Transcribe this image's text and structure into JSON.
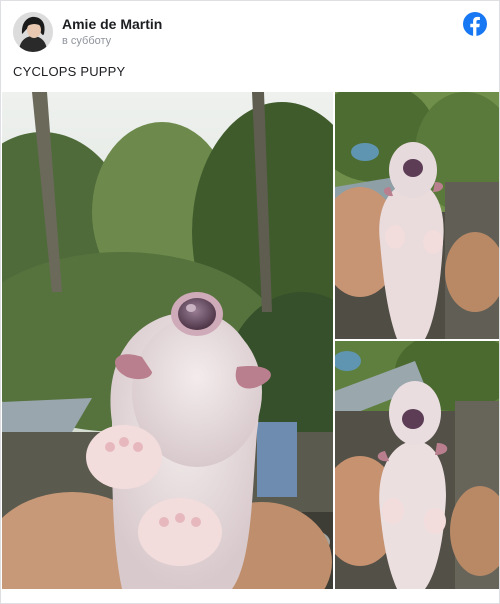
{
  "post": {
    "author": "Amie de Martin",
    "timestamp": "в субботу",
    "text": "CYCLOPS PUPPY"
  },
  "icons": {
    "platform_logo": "facebook-icon",
    "brand_color": "#1877f2"
  },
  "photos": [
    {
      "subject": "puppy-closeup"
    },
    {
      "subject": "puppy-held-top"
    },
    {
      "subject": "puppy-held-bottom"
    }
  ]
}
